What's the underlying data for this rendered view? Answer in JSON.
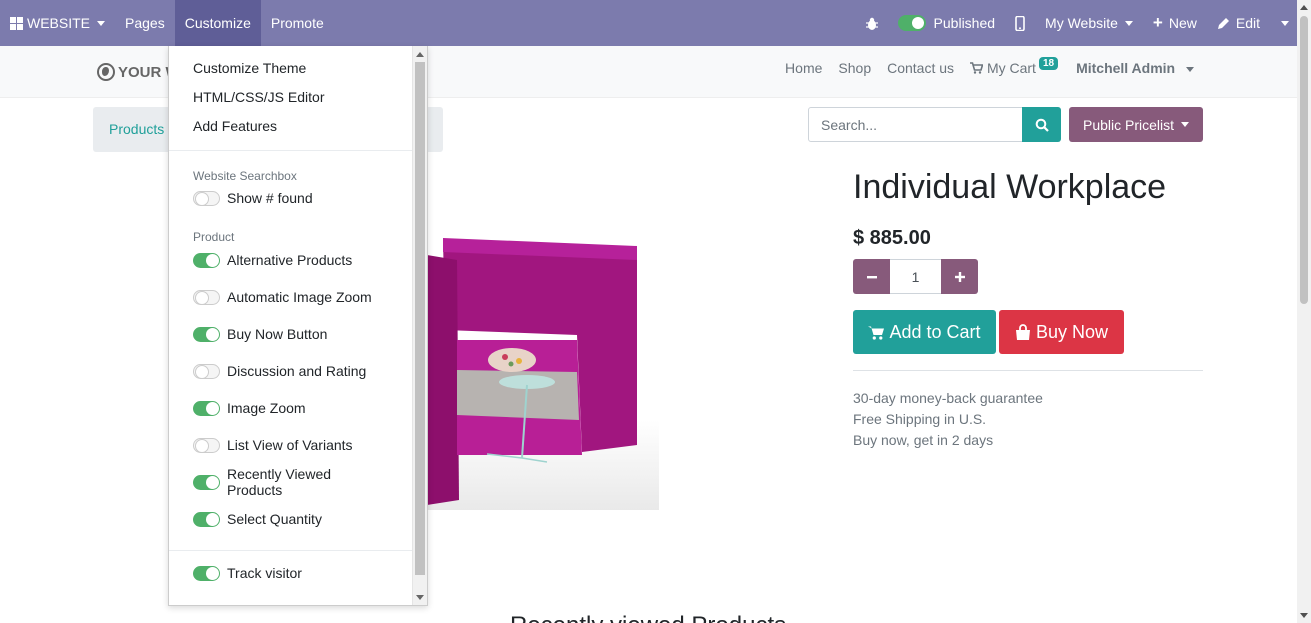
{
  "topbar": {
    "app_label": "WEBSITE",
    "menus": [
      "Pages",
      "Customize",
      "Promote"
    ],
    "published_label": "Published",
    "site_selector": "My Website",
    "new_label": "New",
    "edit_label": "Edit",
    "bg_color": "#7c7bad"
  },
  "site_header": {
    "logo_text": "YOUR W",
    "nav": [
      "Home",
      "Shop",
      "Contact us"
    ],
    "cart_label": "My Cart",
    "cart_count": "18",
    "user_name": "Mitchell Admin"
  },
  "breadcrumb": {
    "first": "Products"
  },
  "search": {
    "placeholder": "Search..."
  },
  "pricelist": {
    "label": "Public Pricelist"
  },
  "product": {
    "title": "Individual Workplace",
    "price": "$ 885.00",
    "quantity": "1",
    "add_to_cart": "Add to Cart",
    "buy_now": "Buy Now",
    "guarantees": [
      "30-day money-back guarantee",
      "Free Shipping in U.S.",
      "Buy now, get in 2 days"
    ]
  },
  "bottom_heading": "Recently viewed Products",
  "customize_menu": {
    "links": [
      "Customize Theme",
      "HTML/CSS/JS Editor",
      "Add Features"
    ],
    "section_searchbox": "Website Searchbox",
    "searchbox_toggles": [
      {
        "label": "Show # found",
        "on": false
      }
    ],
    "section_product": "Product",
    "product_toggles": [
      {
        "label": "Alternative Products",
        "on": true
      },
      {
        "label": "Automatic Image Zoom",
        "on": false
      },
      {
        "label": "Buy Now Button",
        "on": true
      },
      {
        "label": "Discussion and Rating",
        "on": false
      },
      {
        "label": "Image Zoom",
        "on": true
      },
      {
        "label": "List View of Variants",
        "on": false
      },
      {
        "label": "Recently Viewed Products",
        "on": true
      },
      {
        "label": "Select Quantity",
        "on": true
      }
    ],
    "other_toggles": [
      {
        "label": "Track visitor",
        "on": true
      }
    ]
  },
  "colors": {
    "primary": "#21a09a",
    "secondary": "#875a7b",
    "danger": "#dc3545",
    "toggle_on": "#4fb069"
  }
}
